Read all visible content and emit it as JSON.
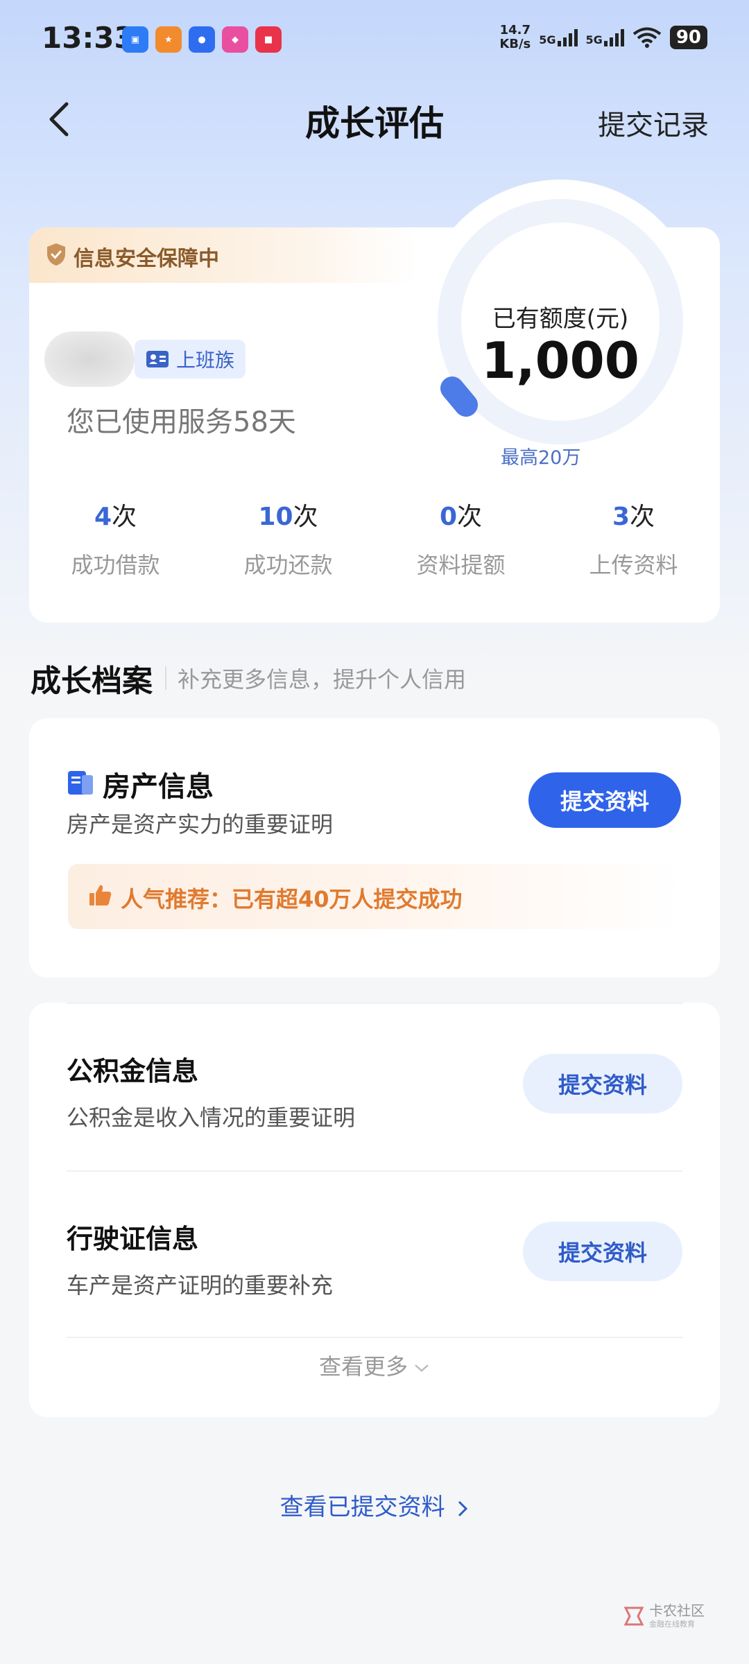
{
  "status_bar": {
    "time": "13:33",
    "speed_value": "14.7",
    "speed_unit": "KB/s",
    "sim1": "5G",
    "sim2": "5G",
    "battery": "90",
    "app_icons": [
      {
        "name": "app-icon-1",
        "color": "#2d7cf6"
      },
      {
        "name": "app-icon-2",
        "color": "#f28a2e"
      },
      {
        "name": "app-icon-3",
        "color": "#2f6df0"
      },
      {
        "name": "app-icon-4",
        "color": "#e94fa0"
      },
      {
        "name": "app-icon-5",
        "color": "#e8334a"
      }
    ]
  },
  "nav": {
    "title": "成长评估",
    "right_link": "提交记录"
  },
  "summary": {
    "security_banner": "信息安全保障中",
    "user_tag": "上班族",
    "usage_text": "您已使用服务58天",
    "quota_label": "已有额度(元)",
    "quota_value": "1,000",
    "quota_max": "最高20万",
    "stats": [
      {
        "value": "4",
        "unit": "次",
        "label": "成功借款"
      },
      {
        "value": "10",
        "unit": "次",
        "label": "成功还款"
      },
      {
        "value": "0",
        "unit": "次",
        "label": "资料提额"
      },
      {
        "value": "3",
        "unit": "次",
        "label": "上传资料"
      }
    ]
  },
  "section": {
    "title": "成长档案",
    "subtitle": "补充更多信息，提升个人信用"
  },
  "property": {
    "title": "房产信息",
    "desc": "房产是资产实力的重要证明",
    "button": "提交资料",
    "popular": "人气推荐：已有超40万人提交成功"
  },
  "items": [
    {
      "title": "公积金信息",
      "desc": "公积金是收入情况的重要证明",
      "button": "提交资料"
    },
    {
      "title": "行驶证信息",
      "desc": "车产是资产证明的重要补充",
      "button": "提交资料"
    }
  ],
  "see_more": "查看更多",
  "view_submitted": "查看已提交资料",
  "watermark": {
    "title": "卡农社区",
    "subtitle": "金融在线教育"
  },
  "colors": {
    "primary": "#2f63ea",
    "accent_text": "#2f5bc9",
    "secondary_btn_bg": "#e9f0fd",
    "popular_text": "#e07a2f",
    "security_text": "#8a5a2b"
  }
}
